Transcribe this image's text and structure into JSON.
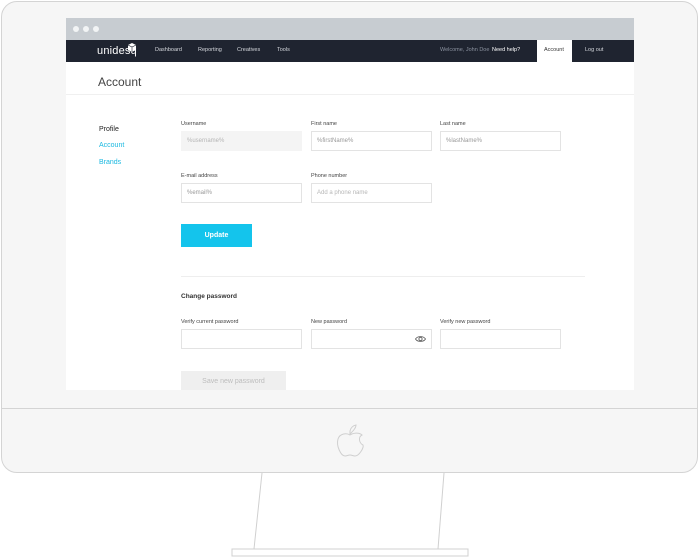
{
  "app": {
    "brand": "unidesq"
  },
  "nav": {
    "links": [
      "Dashboard",
      "Reporting",
      "Creatives",
      "Tools"
    ],
    "welcome": "Welcome, John Doe",
    "help": "Need help?",
    "account": "Account",
    "logout": "Log out"
  },
  "page": {
    "title": "Account"
  },
  "sidebar": {
    "items": [
      "Profile",
      "Account",
      "Brands"
    ]
  },
  "profile_form": {
    "username": {
      "label": "Username",
      "value": "%username%"
    },
    "first_name": {
      "label": "First name",
      "value": "%firstName%"
    },
    "last_name": {
      "label": "Last name",
      "value": "%lastName%"
    },
    "email": {
      "label": "E-mail address",
      "value": "%email%"
    },
    "phone": {
      "label": "Phone number",
      "placeholder": "Add a phone name"
    },
    "update_button": "Update"
  },
  "password_form": {
    "title": "Change password",
    "current": {
      "label": "Verify current password"
    },
    "new": {
      "label": "New password"
    },
    "verify": {
      "label": "Verify new password"
    },
    "save_button": "Save new password"
  },
  "colors": {
    "accent": "#14c4ec",
    "navbar": "#1f2430",
    "titlebar": "#c7ccd1"
  }
}
